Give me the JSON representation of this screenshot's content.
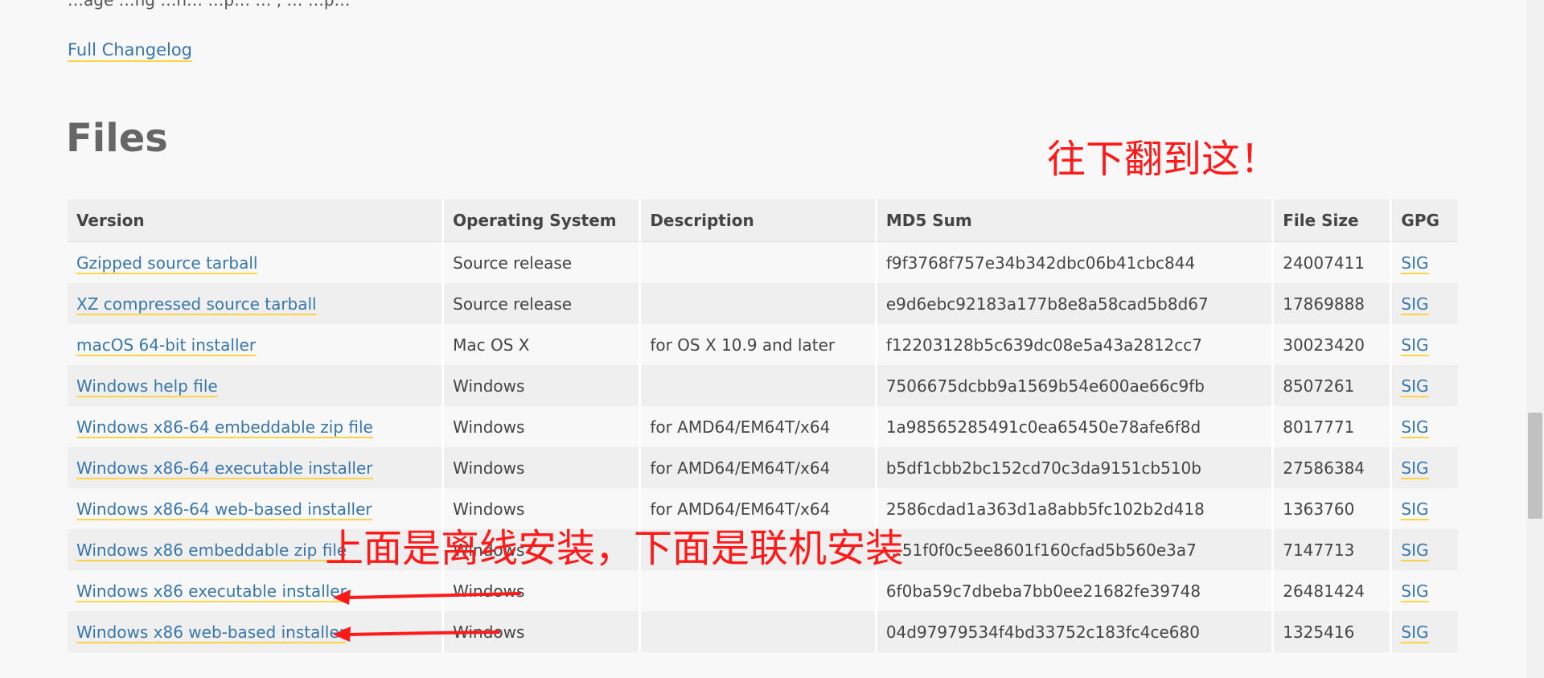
{
  "top_text": "…age  …ng …n…  …p…  …  ,  …  …p…",
  "changelog_label": "Full Changelog",
  "files_heading": "Files",
  "annotations": {
    "scroll_hint": "往下翻到这！",
    "install_note": "上面是离线安装，下面是联机安装",
    "color": "#ff1a1a"
  },
  "table": {
    "headers": {
      "version": "Version",
      "os": "Operating System",
      "description": "Description",
      "md5": "MD5 Sum",
      "size": "File Size",
      "gpg": "GPG"
    },
    "rows": [
      {
        "version": "Gzipped source tarball",
        "os": "Source release",
        "description": "",
        "md5": "f9f3768f757e34b342dbc06b41cbc844",
        "size": "24007411",
        "gpg": "SIG"
      },
      {
        "version": "XZ compressed source tarball",
        "os": "Source release",
        "description": "",
        "md5": "e9d6ebc92183a177b8e8a58cad5b8d67",
        "size": "17869888",
        "gpg": "SIG"
      },
      {
        "version": "macOS 64-bit installer",
        "os": "Mac OS X",
        "description": "for OS X 10.9 and later",
        "md5": "f12203128b5c639dc08e5a43a2812cc7",
        "size": "30023420",
        "gpg": "SIG"
      },
      {
        "version": "Windows help file",
        "os": "Windows",
        "description": "",
        "md5": "7506675dcbb9a1569b54e600ae66c9fb",
        "size": "8507261",
        "gpg": "SIG"
      },
      {
        "version": "Windows x86-64 embeddable zip file",
        "os": "Windows",
        "description": "for AMD64/EM64T/x64",
        "md5": "1a98565285491c0ea65450e78afe6f8d",
        "size": "8017771",
        "gpg": "SIG"
      },
      {
        "version": "Windows x86-64 executable installer",
        "os": "Windows",
        "description": "for AMD64/EM64T/x64",
        "md5": "b5df1cbb2bc152cd70c3da9151cb510b",
        "size": "27586384",
        "gpg": "SIG"
      },
      {
        "version": "Windows x86-64 web-based installer",
        "os": "Windows",
        "description": "for AMD64/EM64T/x64",
        "md5": "2586cdad1a363d1a8abb5fc102b2d418",
        "size": "1363760",
        "gpg": "SIG"
      },
      {
        "version": "Windows x86 embeddable zip file",
        "os": "Windows",
        "description": "",
        "md5": "…51f0f0c5ee8601f160cfad5b560e3a7",
        "size": "7147713",
        "gpg": "SIG"
      },
      {
        "version": "Windows x86 executable installer",
        "os": "Windows",
        "description": "",
        "md5": "6f0ba59c7dbeba7bb0ee21682fe39748",
        "size": "26481424",
        "gpg": "SIG"
      },
      {
        "version": "Windows x86 web-based installer",
        "os": "Windows",
        "description": "",
        "md5": "04d97979534f4bd33752c183fc4ce680",
        "size": "1325416",
        "gpg": "SIG"
      }
    ]
  },
  "colors": {
    "link": "#3776ab",
    "link_underline": "#ffd343",
    "background": "#f8f8f8"
  }
}
